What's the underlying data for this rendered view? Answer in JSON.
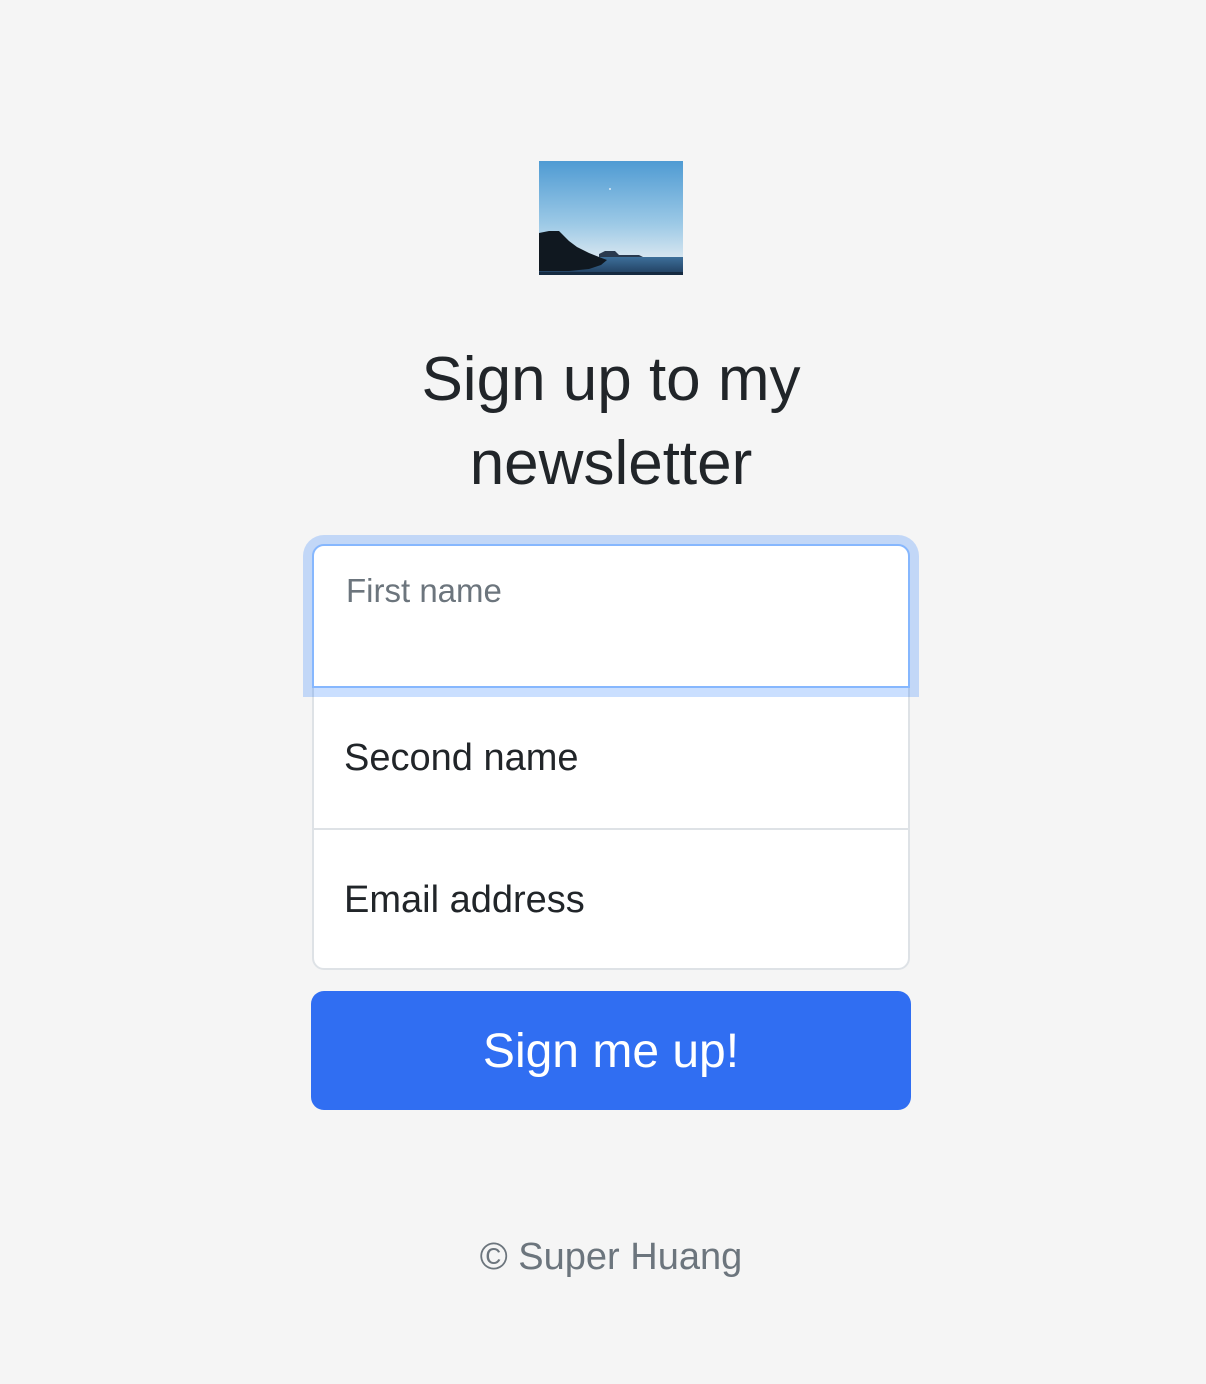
{
  "hero": {
    "image_label": "coastal landscape photo"
  },
  "title": "Sign up to my newsletter",
  "form": {
    "first_name_placeholder": "First name",
    "second_name_label": "Second name",
    "email_label": "Email address",
    "first_name_focused": true,
    "focus_ring_color": "#86b7fe"
  },
  "submit": {
    "label": "Sign me up!",
    "color": "#306ef2"
  },
  "footer": {
    "text": "© Super Huang"
  },
  "colors": {
    "background": "#f5f5f5",
    "text": "#212529",
    "muted": "#6c757d"
  }
}
